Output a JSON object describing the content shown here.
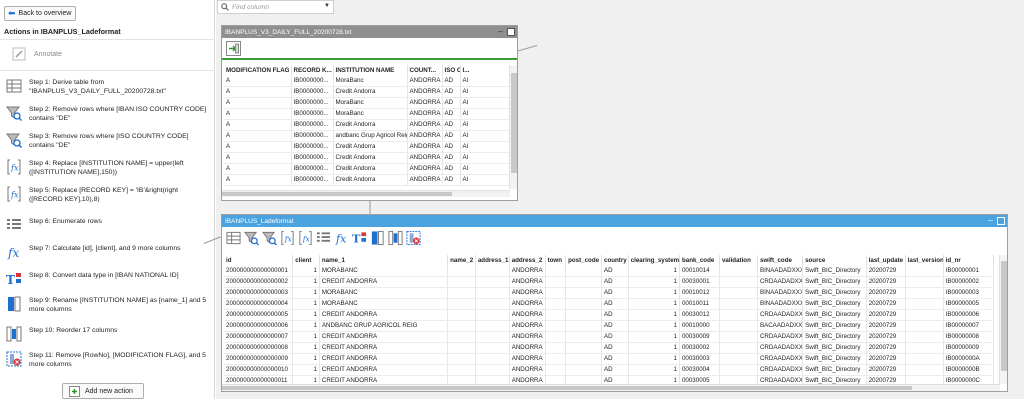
{
  "back_label": "Back to overview",
  "actions_title": "Actions in IBANPLUS_Ladeformat",
  "annotate_label": "Annotate",
  "add_action_label": "Add new action",
  "steps": [
    {
      "icon": "table-icon",
      "text": "Step 1: Derive table from \"IBANPLUS_V3_DAILY_FULL_20200728.txt\""
    },
    {
      "icon": "filter-icon",
      "text": "Step 2: Remove rows where [IBAN ISO COUNTRY CODE] contains \"DE\""
    },
    {
      "icon": "filter-icon",
      "text": "Step 3: Remove rows where [ISO COUNTRY CODE] contains \"DE\""
    },
    {
      "icon": "formula-bracket-icon",
      "text": "Step 4: Replace [INSTITUTION NAME] = upper(left ([INSTITUTION NAME],150))"
    },
    {
      "icon": "formula-bracket-icon",
      "text": "Step 5: Replace [RECORD KEY] = 'IB'&right(right ([RECORD KEY],10),8)"
    },
    {
      "icon": "enumerate-icon",
      "text": "Step 6: Enumerate rows"
    },
    {
      "icon": "function-icon",
      "text": "Step 7: Calculate [id], [client], and 9 more columns"
    },
    {
      "icon": "convert-type-icon",
      "text": "Step 8: Convert data type in [IBAN NATIONAL ID]"
    },
    {
      "icon": "rename-icon",
      "text": "Step 9: Rename [INSTITUTION NAME] as [name_1] and 5 more columns"
    },
    {
      "icon": "reorder-icon",
      "text": "Step 10: Reorder 17 columns"
    },
    {
      "icon": "remove-columns-icon",
      "text": "Step 11: Remove [RowNo], [MODIFICATION FLAG], and 5 more columns"
    }
  ],
  "search": {
    "placeholder": "Find column"
  },
  "source_window": {
    "title": "IBANPLUS_V3_DAILY_FULL_20200728.txt",
    "columns": [
      "MODIFICATION FLAG",
      "RECORD K...",
      "INSTITUTION NAME",
      "COUNT...",
      "ISO C...",
      "I..."
    ],
    "rows": [
      [
        "A",
        "IB0000000...",
        "MoraBanc",
        "ANDORRA",
        "AD",
        "Al"
      ],
      [
        "A",
        "IB0000000...",
        "Credit Andorra",
        "ANDORRA",
        "AD",
        "Al"
      ],
      [
        "A",
        "IB0000000...",
        "MoraBanc",
        "ANDORRA",
        "AD",
        "Al"
      ],
      [
        "A",
        "IB0000000...",
        "MoraBanc",
        "ANDORRA",
        "AD",
        "Al"
      ],
      [
        "A",
        "IB0000000...",
        "Credit Andorra",
        "ANDORRA",
        "AD",
        "Al"
      ],
      [
        "A",
        "IB0000000...",
        "andbanc Grup Agricol Reig",
        "ANDORRA",
        "AD",
        "Al"
      ],
      [
        "A",
        "IB0000000...",
        "Credit Andorra",
        "ANDORRA",
        "AD",
        "Al"
      ],
      [
        "A",
        "IB0000000...",
        "Credit Andorra",
        "ANDORRA",
        "AD",
        "Al"
      ],
      [
        "A",
        "IB0000000...",
        "Credit Andorra",
        "ANDORRA",
        "AD",
        "Al"
      ],
      [
        "A",
        "IB0000000...",
        "Credit Andorra",
        "ANDORRA",
        "AD",
        "Al"
      ]
    ]
  },
  "result_window": {
    "title": "IBANPLUS_Ladeformat",
    "columns": [
      "id",
      "client",
      "name_1",
      "name_2",
      "address_1",
      "address_2",
      "town",
      "post_code",
      "country",
      "clearing_system",
      "bank_code",
      "validation",
      "swift_code",
      "source",
      "last_update",
      "last_version",
      "id_nr"
    ],
    "rows": [
      [
        "200000000000000001",
        "1",
        "MORABANC",
        "",
        "",
        "ANDORRA",
        "",
        "",
        "AD",
        "1",
        "00010014",
        "",
        "BINAADADXXX",
        "Swift_BIC_Directory",
        "20200729",
        "",
        "IB00000001"
      ],
      [
        "200000000000000002",
        "1",
        "CREDIT ANDORRA",
        "",
        "",
        "ANDORRA",
        "",
        "",
        "AD",
        "1",
        "00030001",
        "",
        "CRDAADADXXX",
        "Swift_BIC_Directory",
        "20200729",
        "",
        "IB00000002"
      ],
      [
        "200000000000000003",
        "1",
        "MORABANC",
        "",
        "",
        "ANDORRA",
        "",
        "",
        "AD",
        "1",
        "00010012",
        "",
        "BINAADADXXX",
        "Swift_BIC_Directory",
        "20200729",
        "",
        "IB00000003"
      ],
      [
        "200000000000000004",
        "1",
        "MORABANC",
        "",
        "",
        "ANDORRA",
        "",
        "",
        "AD",
        "1",
        "00010011",
        "",
        "BINAADADXXX",
        "Swift_BIC_Directory",
        "20200729",
        "",
        "IB00000005"
      ],
      [
        "200000000000000005",
        "1",
        "CREDIT ANDORRA",
        "",
        "",
        "ANDORRA",
        "",
        "",
        "AD",
        "1",
        "00030012",
        "",
        "CRDAADADXXX",
        "Swift_BIC_Directory",
        "20200729",
        "",
        "IB00000006"
      ],
      [
        "200000000000000006",
        "1",
        "ANDBANC GRUP AGRICOL REIG",
        "",
        "",
        "ANDORRA",
        "",
        "",
        "AD",
        "1",
        "00010000",
        "",
        "BACAADADXXX",
        "Swift_BIC_Directory",
        "20200729",
        "",
        "IB00000007"
      ],
      [
        "200000000000000007",
        "1",
        "CREDIT ANDORRA",
        "",
        "",
        "ANDORRA",
        "",
        "",
        "AD",
        "1",
        "00030009",
        "",
        "CRDAADADXXX",
        "Swift_BIC_Directory",
        "20200729",
        "",
        "IB00000008"
      ],
      [
        "200000000000000008",
        "1",
        "CREDIT ANDORRA",
        "",
        "",
        "ANDORRA",
        "",
        "",
        "AD",
        "1",
        "00030002",
        "",
        "CRDAADADXXX",
        "Swift_BIC_Directory",
        "20200729",
        "",
        "IB00000009"
      ],
      [
        "200000000000000009",
        "1",
        "CREDIT ANDORRA",
        "",
        "",
        "ANDORRA",
        "",
        "",
        "AD",
        "1",
        "00030003",
        "",
        "CRDAADADXXX",
        "Swift_BIC_Directory",
        "20200729",
        "",
        "IB0000000A"
      ],
      [
        "200000000000000010",
        "1",
        "CREDIT ANDORRA",
        "",
        "",
        "ANDORRA",
        "",
        "",
        "AD",
        "1",
        "00030004",
        "",
        "CRDAADADXXX",
        "Swift_BIC_Directory",
        "20200729",
        "",
        "IB0000000B"
      ],
      [
        "200000000000000011",
        "1",
        "CREDIT ANDORRA",
        "",
        "",
        "ANDORRA",
        "",
        "",
        "AD",
        "1",
        "00030005",
        "",
        "CRDAADADXXX",
        "Swift_BIC_Directory",
        "20200729",
        "",
        "IB0000000C"
      ]
    ]
  },
  "colors": {
    "accent": "#1f6fd0",
    "titlebar_inactive": "#8f8f8f",
    "titlebar_active": "#4aa3df",
    "panel_bg": "#f0f0f0"
  }
}
